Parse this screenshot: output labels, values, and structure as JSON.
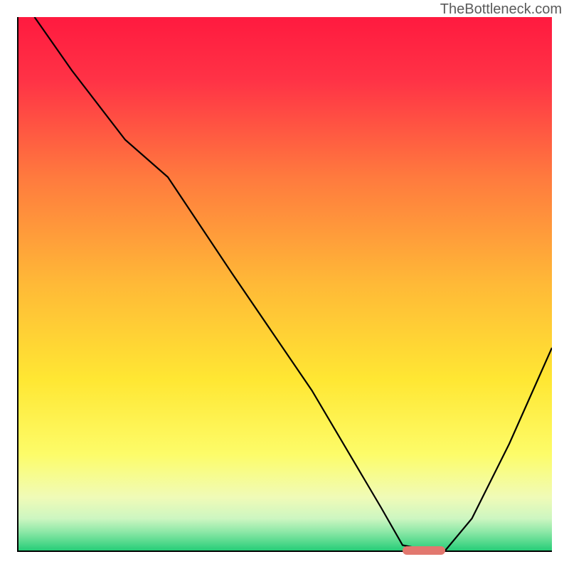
{
  "watermark": "TheBottleneck.com",
  "chart_data": {
    "type": "line",
    "title": "",
    "xlabel": "",
    "ylabel": "",
    "xlim": [
      0,
      100
    ],
    "ylim": [
      0,
      100
    ],
    "grid": false,
    "legend": false,
    "background_gradient": {
      "stops": [
        {
          "pos": 0.0,
          "color": "#ff1a3f"
        },
        {
          "pos": 0.12,
          "color": "#ff3346"
        },
        {
          "pos": 0.3,
          "color": "#ff7a3e"
        },
        {
          "pos": 0.5,
          "color": "#ffb937"
        },
        {
          "pos": 0.68,
          "color": "#ffe733"
        },
        {
          "pos": 0.82,
          "color": "#fdfc69"
        },
        {
          "pos": 0.9,
          "color": "#f0fbb7"
        },
        {
          "pos": 0.94,
          "color": "#cdf6c1"
        },
        {
          "pos": 0.965,
          "color": "#8de8a7"
        },
        {
          "pos": 1.0,
          "color": "#27cd78"
        }
      ]
    },
    "series": [
      {
        "name": "bottleneck-curve",
        "color": "#000000",
        "x": [
          3,
          10,
          20,
          28,
          40,
          55,
          68,
          72,
          77,
          80,
          85,
          92,
          100
        ],
        "y": [
          100,
          90,
          77,
          70,
          52,
          30,
          8,
          1,
          0,
          0,
          6,
          20,
          38
        ]
      }
    ],
    "marker": {
      "name": "optimal-range",
      "color": "#e2786f",
      "x_start": 72,
      "x_end": 80,
      "y": 0
    }
  }
}
